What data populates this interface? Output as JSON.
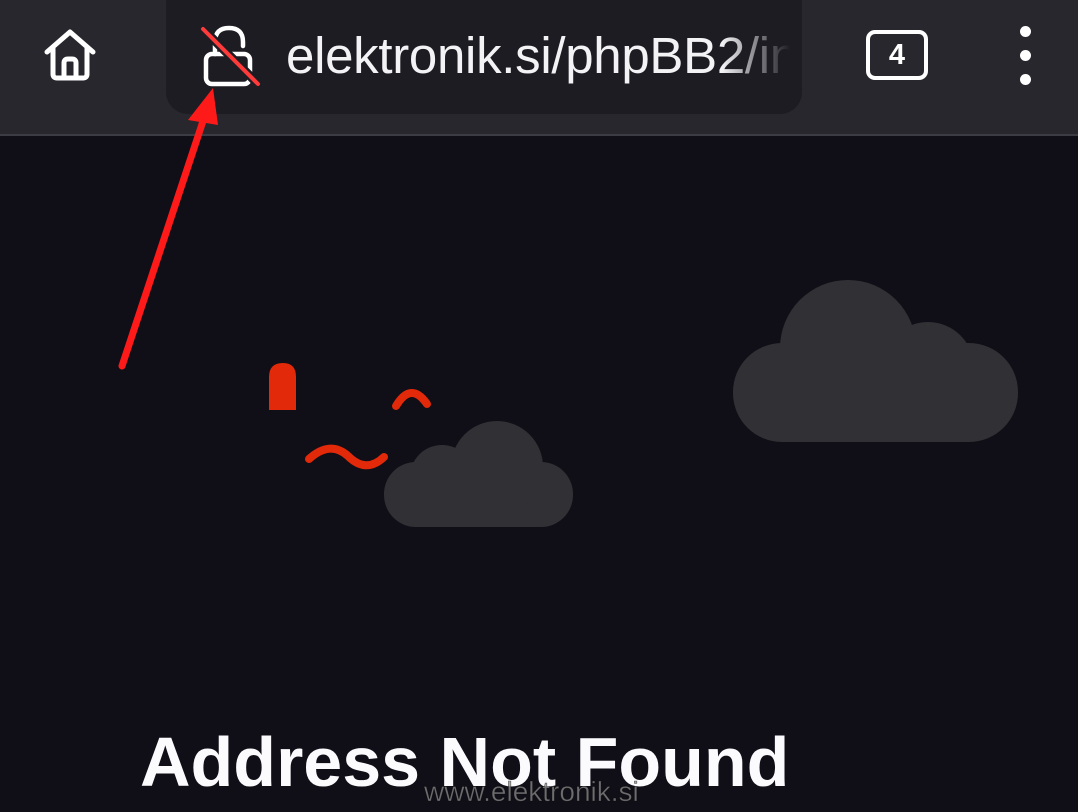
{
  "browser": {
    "url_text": "elektronik.si/phpBB2/in",
    "tab_count": "4",
    "icons": {
      "home": "home-icon",
      "security": "broken-lock-icon",
      "tabs": "tab-counter-icon",
      "menu": "kebab-menu-icon"
    }
  },
  "page": {
    "heading": "Address Not Found"
  },
  "watermark": "www.elektronik.si",
  "colors": {
    "toolbar": "#27272d",
    "url_bar": "#1d1c23",
    "page_background": "#100f17",
    "cloud": "#313035",
    "dino": "#e22a0a",
    "annotation_arrow": "#ff1a1a",
    "lock_strike": "#ff3a3a"
  }
}
